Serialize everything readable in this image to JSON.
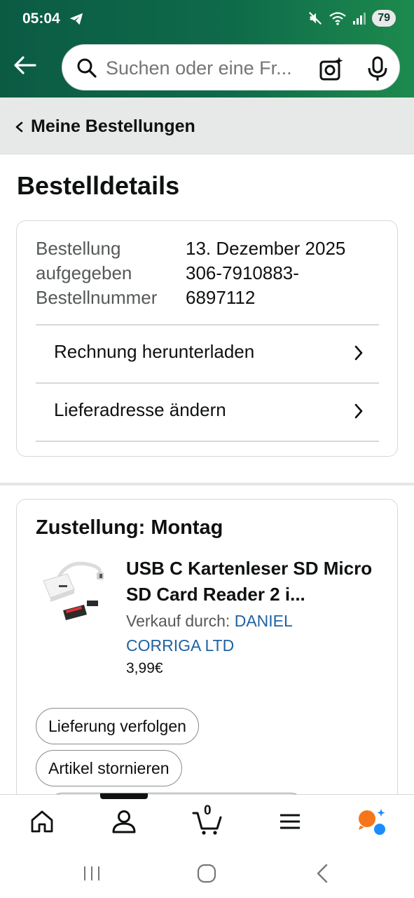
{
  "status": {
    "time": "05:04",
    "battery": "79"
  },
  "search": {
    "placeholder": "Suchen oder eine Fr..."
  },
  "breadcrumb": {
    "label": "Meine Bestellungen"
  },
  "page": {
    "title": "Bestelldetails"
  },
  "order": {
    "placed_label": "Bestellung aufgegeben",
    "placed_label_line1": "Bestellung",
    "placed_label_line2": "aufgegeben",
    "placed_value": "13. Dezember 2025",
    "number_label": "Bestellnummer",
    "number_value_line1": "306-7910883-",
    "number_value_line2": "6897112",
    "links": [
      {
        "label": "Rechnung herunterladen"
      },
      {
        "label": "Lieferadresse ändern"
      }
    ]
  },
  "delivery": {
    "title": "Zustellung: Montag",
    "product": {
      "title": "USB C Kartenleser SD Micro SD Card Reader 2 i...",
      "sold_by_label": "Verkauf durch:",
      "seller": "DANIEL CORRIGA LTD",
      "price": "3,99€"
    },
    "buttons": [
      {
        "label": "Lieferung verfolgen"
      },
      {
        "label": "Artikel stornieren"
      }
    ]
  },
  "bottom_nav": {
    "cart_count": "0"
  },
  "colors": {
    "brand_green": "#0e6a4a",
    "link_blue": "#2162a1",
    "assistant_orange": "#f5761a",
    "assistant_blue": "#1a8cff"
  }
}
